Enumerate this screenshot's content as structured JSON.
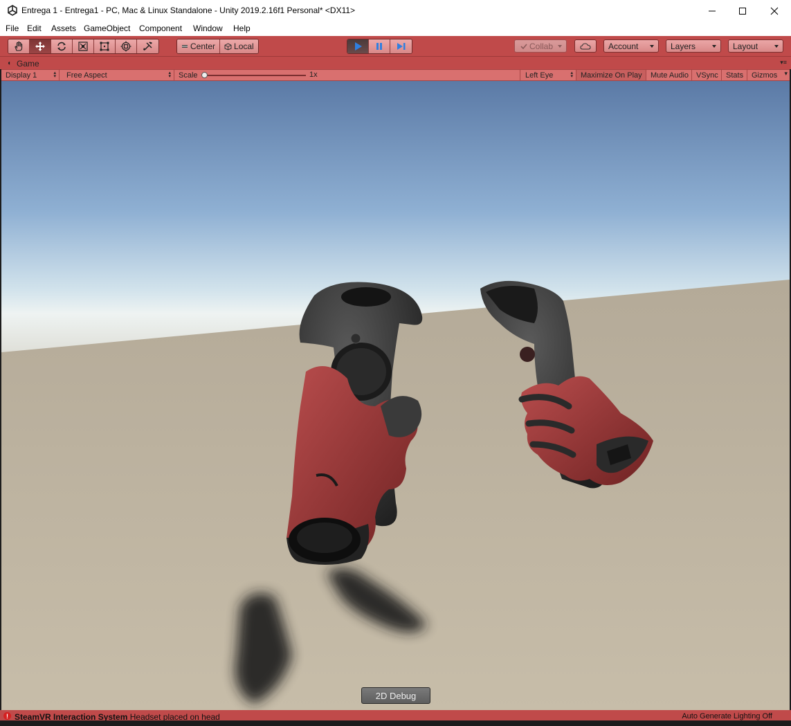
{
  "window": {
    "title": "Entrega 1 - Entrega1 - PC, Mac & Linux Standalone - Unity 2019.2.16f1 Personal* <DX11>",
    "icon": "unity-logo-icon",
    "controls": [
      "minimize-icon",
      "maximize-icon",
      "close-icon"
    ]
  },
  "menu": {
    "items": [
      "File",
      "Edit",
      "Assets",
      "GameObject",
      "Component",
      "Window",
      "Help"
    ]
  },
  "toolbar": {
    "tools": [
      "hand-tool-icon",
      "move-tool-icon",
      "rotate-tool-icon",
      "scale-tool-icon",
      "rect-tool-icon",
      "transform-tool-icon",
      "custom-tool-icon"
    ],
    "active_tool": "move-tool-icon",
    "pivot_center": "Center",
    "pivot_local": "Local",
    "playback": [
      "play-icon",
      "pause-icon",
      "step-icon"
    ],
    "collab": "Collab",
    "cloud": "cloud-icon",
    "account": "Account",
    "layers": "Layers",
    "layout": "Layout",
    "accent_color": "#c04a4a"
  },
  "game_tab": {
    "label": "Game",
    "icon": "pacman-icon"
  },
  "game_bar": {
    "display": "Display 1",
    "aspect": "Free Aspect",
    "scale_label": "Scale",
    "scale_value": "1x",
    "eye": "Left Eye",
    "maximize": "Maximize On Play",
    "mute": "Mute Audio",
    "vsync": "VSync",
    "stats": "Stats",
    "gizmos": "Gizmos"
  },
  "viewport": {
    "debug_button": "2D Debug"
  },
  "status": {
    "source": "SteamVR Interaction System",
    "message": "Headset placed on head",
    "right": "Auto Generate Lighting Off",
    "icon": "error-icon"
  }
}
